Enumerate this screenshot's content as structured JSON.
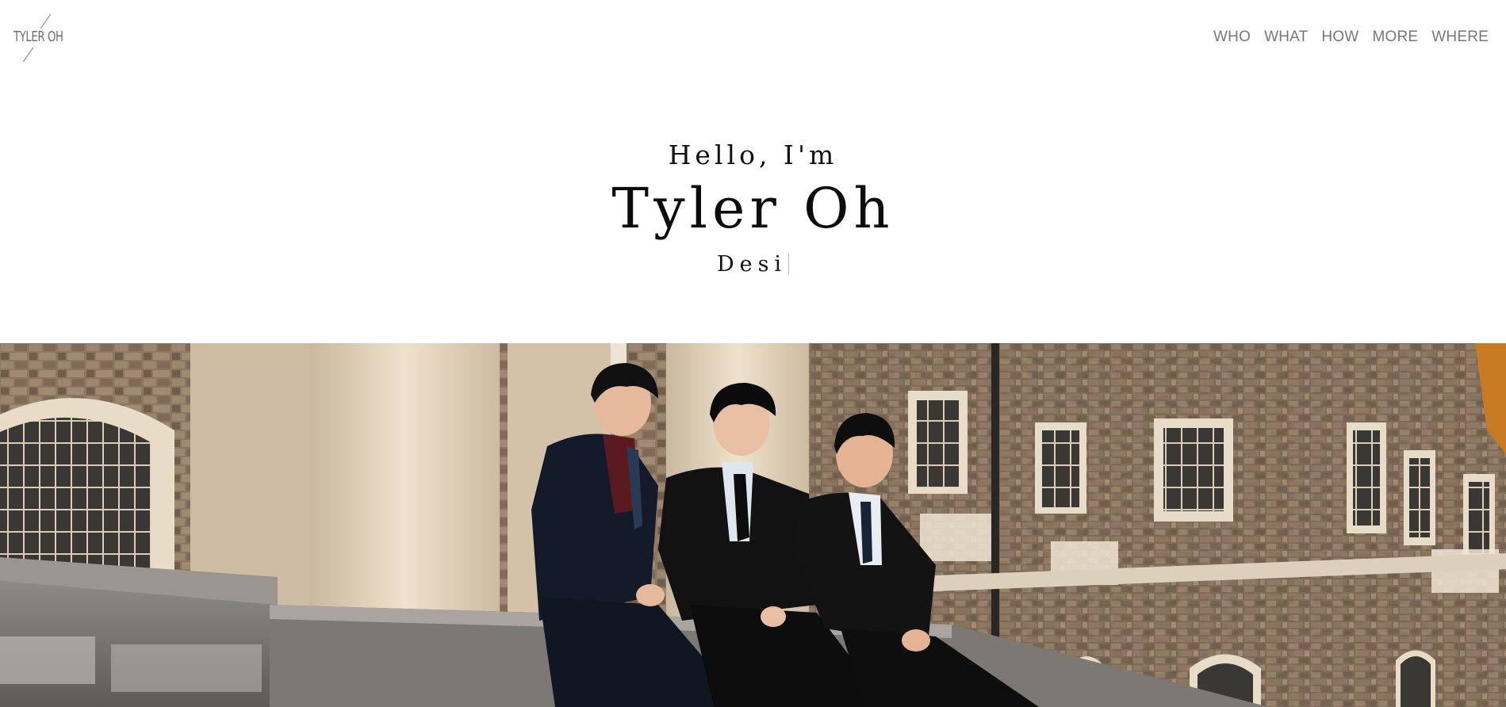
{
  "header": {
    "logo_text": "TYLER OH",
    "nav": [
      "WHO",
      "WHAT",
      "HOW",
      "MORE",
      "WHERE"
    ]
  },
  "hero": {
    "greeting": "Hello, I'm",
    "name": "Tyler Oh",
    "typed_text": "Desi"
  },
  "photo": {
    "description_icon": "group-photo"
  },
  "colors": {
    "nav_text": "#777777",
    "heading_text": "#0c0c0c",
    "background": "#ffffff"
  }
}
